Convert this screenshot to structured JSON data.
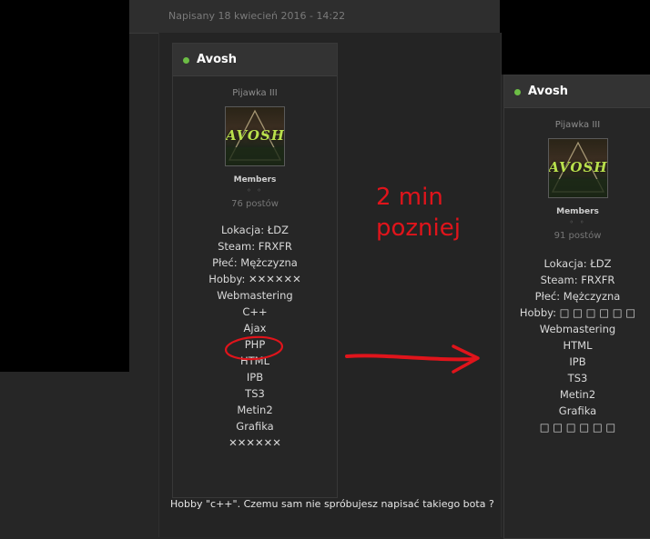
{
  "post": {
    "date": "Napisany 18 kwiecień 2016 - 14:22",
    "comment": "Hobby \"c++\". Czemu sam nie spróbujesz napisać takiego bota ?"
  },
  "annotation": {
    "line1": "2 min",
    "line2": "pozniej",
    "color": "#e0141b"
  },
  "profile_before": {
    "username": "Avosh",
    "rank": "Pijawka III",
    "avatar_text": "AVOSH",
    "group": "Members",
    "pips": "◦ ◦",
    "post_count": "76 postów",
    "fields": [
      "Lokacja: ŁDZ",
      "Steam: FRXFR",
      "Płeć: Mężczyzna",
      "Hobby: ✕✕✕✕✕✕",
      "Webmastering",
      "C++",
      "Ajax",
      "PHP",
      "HTML",
      "IPB",
      "TS3",
      "Metin2",
      "Grafika",
      "✕✕✕✕✕✕"
    ]
  },
  "profile_after": {
    "username": "Avosh",
    "rank": "Pijawka III",
    "avatar_text": "AVOSH",
    "group": "Members",
    "pips": "◦ ◦",
    "post_count": "91 postów",
    "fields": [
      "Lokacja: ŁDZ",
      "Steam: FRXFR",
      "Płeć: Mężczyzna",
      "Hobby: □ □ □ □ □ □",
      "Webmastering",
      "HTML",
      "IPB",
      "TS3",
      "Metin2",
      "Grafika",
      "□ □ □ □ □ □"
    ]
  },
  "colors": {
    "online": "#6cbd45",
    "accent_avatar": "#b9e04c"
  }
}
